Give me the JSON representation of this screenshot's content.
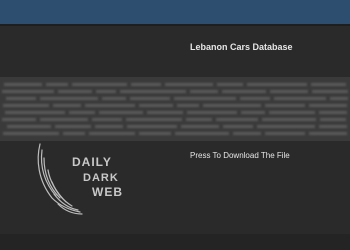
{
  "header": {
    "bar_color": "#2d4e6f"
  },
  "post": {
    "title": "Lebanon Cars Database",
    "download_label": "Press To Download The File"
  },
  "logo": {
    "line1": "DAILY",
    "line2": "DARK",
    "line3": "WEB",
    "icon": "wing-icon"
  }
}
